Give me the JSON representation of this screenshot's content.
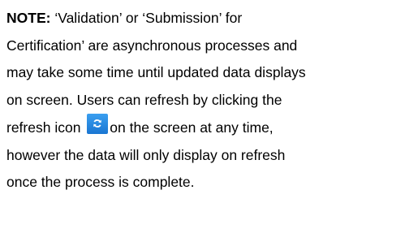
{
  "note": {
    "label": "NOTE:",
    "line1_rest": " ‘Validation’ or ‘Submission’ for",
    "line2": "Certification’ are asynchronous processes and",
    "line3": "may take some time until updated data displays",
    "line4": "on screen. Users can refresh by clicking the",
    "line5_before_icon": "refresh icon ",
    "line5_after_icon": "on the screen at any time,",
    "line6": "however the data will only display on refresh",
    "line7": "once the process is complete."
  },
  "refresh_icon": {
    "icon": "refresh-icon",
    "background_color": "#2a8be6",
    "glyph_color": "#ffffff"
  }
}
